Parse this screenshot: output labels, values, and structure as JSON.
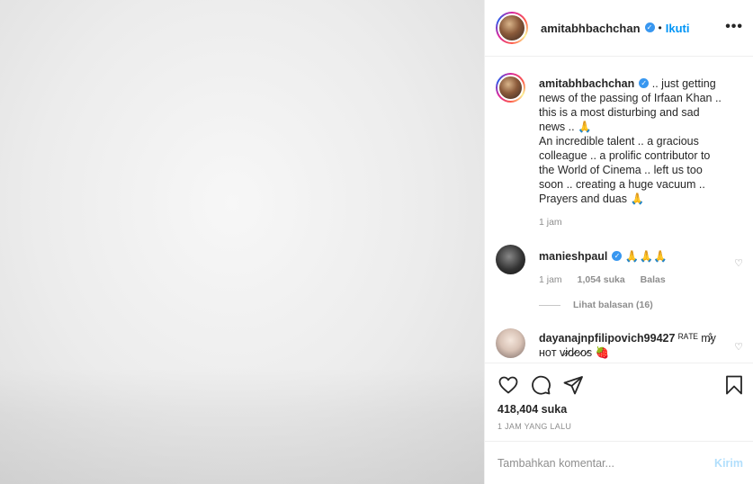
{
  "post": {
    "username": "amitabhbachchan",
    "follow_label": "Ikuti",
    "separator": "•",
    "more_glyph": "•••"
  },
  "caption": {
    "username": "amitabhbachchan",
    "lines": [
      ".. just getting news of the passing of Irfaan Khan .. this is a most disturbing and sad news .. 🙏",
      "An incredible talent .. a gracious colleague .. a prolific contributor to the World of Cinema .. left us too soon .. creating a huge vacuum .. Prayers and duas 🙏"
    ],
    "time": "1 jam"
  },
  "comments": [
    {
      "username": "manieshpaul",
      "verified": true,
      "text": "🙏🙏🙏",
      "time": "1 jam",
      "likes": "1,054 suka",
      "reply_label": "Balas",
      "view_replies": "Lihat balasan (16)"
    },
    {
      "username": "dayanajnpfilipovich99427",
      "verified": false,
      "text": "ᴿᴬᵀᴱ m̷̐y ʜᴏᴛ v̷i̷d̷e̷o̷s 🍓"
    }
  ],
  "actions": {
    "icons": [
      "heart-icon",
      "comment-icon",
      "share-icon",
      "bookmark-icon"
    ],
    "likes_count": "418,404 suka",
    "timestamp": "1 JAM YANG LALU"
  },
  "comment_input": {
    "placeholder": "Tambahkan komentar...",
    "post_label": "Kirim"
  },
  "colors": {
    "link_blue": "#0095f6",
    "verified_blue": "#3897f0",
    "muted": "#8e8e8e"
  }
}
